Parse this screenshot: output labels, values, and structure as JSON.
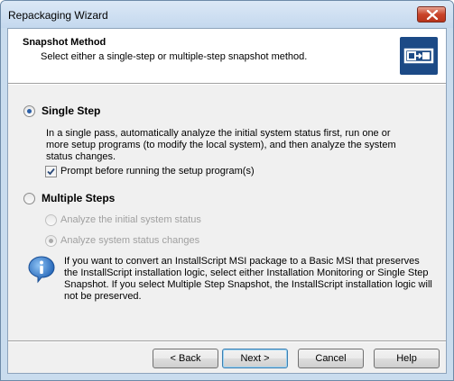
{
  "window": {
    "title": "Repackaging Wizard"
  },
  "header": {
    "title": "Snapshot Method",
    "subtitle": "Select either a single-step or multiple-step snapshot method.",
    "icon": "snapshot-wizard-icon"
  },
  "options": {
    "single_step": {
      "label": "Single Step",
      "selected": true,
      "description": "In a single pass, automatically analyze the initial system status first, run one or more setup programs (to modify the local system), and then analyze the system status changes.",
      "prompt_checkbox": {
        "label": "Prompt before running the setup program(s)",
        "checked": true
      }
    },
    "multiple_steps": {
      "label": "Multiple Steps",
      "selected": false,
      "sub_options": [
        {
          "label": "Analyze the initial system status",
          "selected": false,
          "enabled": false
        },
        {
          "label": "Analyze system status changes",
          "selected": true,
          "enabled": false
        }
      ]
    }
  },
  "info": {
    "icon": "info-icon",
    "text": "If you want to convert an InstallScript MSI package to a Basic MSI that preserves the InstallScript installation logic, select either Installation Monitoring or Single Step Snapshot. If you select Multiple Step Snapshot, the InstallScript installation logic will not be preserved."
  },
  "buttons": {
    "back": "< Back",
    "next": "Next >",
    "cancel": "Cancel",
    "help": "Help"
  },
  "colors": {
    "accent": "#1c4a86",
    "frame": "#c9dcee",
    "close": "#c9442a"
  }
}
